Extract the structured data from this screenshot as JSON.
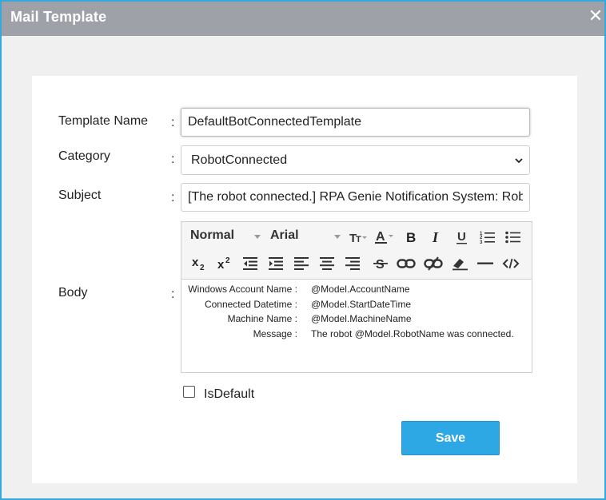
{
  "dialog": {
    "title": "Mail Template",
    "close_glyph": "✕"
  },
  "form": {
    "colon": ":",
    "template_name": {
      "label": "Template Name",
      "value": "DefaultBotConnectedTemplate"
    },
    "category": {
      "label": "Category",
      "selected": "RobotConnected"
    },
    "subject": {
      "label": "Subject",
      "value": "[The robot connected.] RPA Genie Notification System: Rob"
    },
    "body": {
      "label": "Body"
    },
    "is_default": {
      "label": "IsDefault",
      "checked": false
    },
    "save_label": "Save"
  },
  "editor": {
    "toolbar": {
      "header_select": "Normal",
      "font_select": "Arial",
      "icons": [
        "text-size-icon",
        "font-color-icon",
        "bold-icon",
        "italic-icon",
        "underline-icon",
        "ordered-list-icon",
        "bullet-list-icon",
        "subscript-icon",
        "superscript-icon",
        "outdent-icon",
        "indent-icon",
        "align-left-icon",
        "align-center-icon",
        "align-right-icon",
        "strikethrough-icon",
        "link-icon",
        "unlink-icon",
        "clean-format-icon",
        "horizontal-rule-icon",
        "code-view-icon"
      ]
    },
    "rows": [
      {
        "key": "Windows Account Name :",
        "value": "@Model.AccountName"
      },
      {
        "key": "Connected Datetime :",
        "value": "@Model.StartDateTime"
      },
      {
        "key": "Machine Name :",
        "value": "@Model.MachineName"
      },
      {
        "key": "Message :",
        "value": "The robot @Model.RobotName was connected."
      }
    ]
  },
  "colors": {
    "title_bar": "#9ea2a8",
    "accent_border": "#35a8de",
    "save_button": "#2ea8e4"
  }
}
